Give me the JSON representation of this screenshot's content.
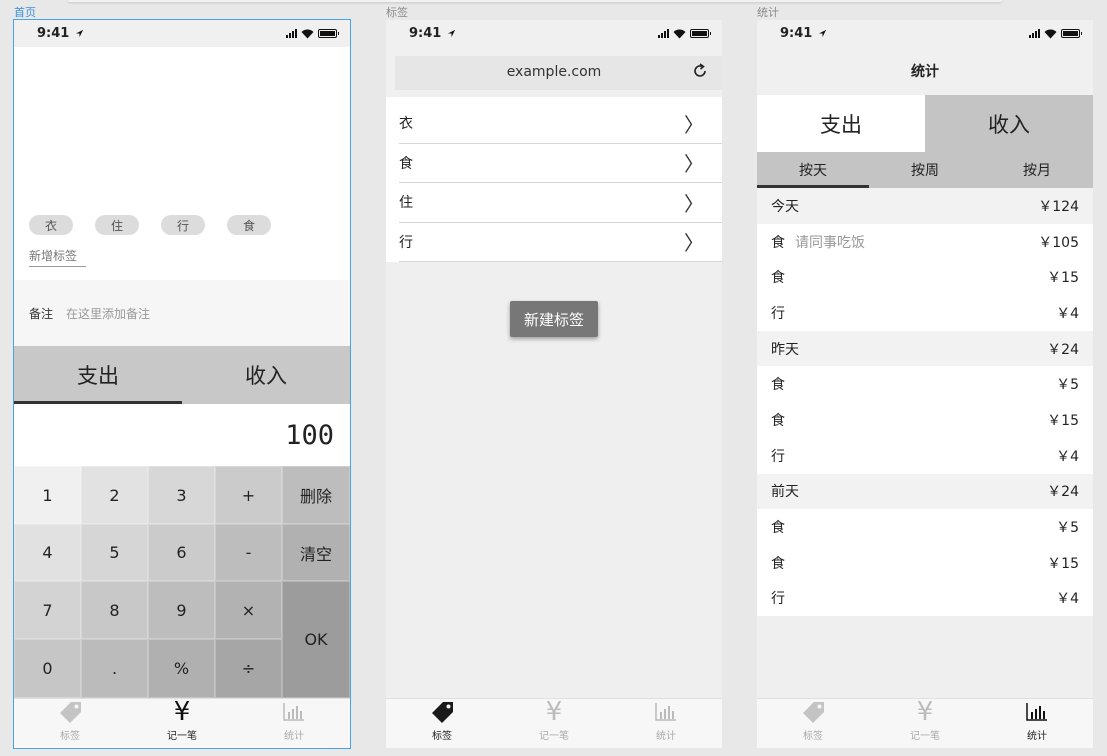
{
  "artboards": {
    "home": "首页",
    "tags": "标签",
    "stats": "统计"
  },
  "status": {
    "time": "9:41"
  },
  "home": {
    "tags": [
      "衣",
      "住",
      "行",
      "食"
    ],
    "new_tag": "新增标签",
    "note_label": "备注",
    "note_placeholder": "在这里添加备注",
    "types": [
      "支出",
      "收入"
    ],
    "amount": "100",
    "keys": [
      "1",
      "2",
      "3",
      "+",
      "删除",
      "4",
      "5",
      "6",
      "-",
      "清空",
      "7",
      "8",
      "9",
      "×",
      "OK",
      "0",
      ".",
      "%",
      "÷"
    ],
    "key_colors": {
      "k1": "#f0f0f0",
      "k2": "#e2e2e2",
      "k3": "#d7d7d7",
      "kplus": "#cbcbcb",
      "kdel": "#bdbdbd",
      "k4": "#e1e1e1",
      "k5": "#d6d6d6",
      "k6": "#cbcbcb",
      "kminus": "#bdbdbd",
      "kclr": "#b1b1b1",
      "k7": "#d3d3d3",
      "k8": "#c8c8c8",
      "k9": "#bdbdbd",
      "kmul": "#b2b2b2",
      "kok": "#9c9c9c",
      "k0": "#c6c6c6",
      "kdot": "#bbbbbb",
      "kpct": "#b0b0b0",
      "kdiv": "#a6a6a6"
    }
  },
  "tabbar": {
    "tags": "标签",
    "record": "记一笔",
    "stats": "统计"
  },
  "tags_page": {
    "url": "example.com",
    "categories": [
      "衣",
      "食",
      "住",
      "行"
    ],
    "new_button": "新建标签"
  },
  "stats_page": {
    "title": "统计",
    "types": [
      "支出",
      "收入"
    ],
    "periods": [
      "按天",
      "按周",
      "按月"
    ],
    "rows": [
      {
        "label": "今天",
        "note": "",
        "amount": "￥124",
        "header": true
      },
      {
        "label": "食",
        "note": "请同事吃饭",
        "amount": "￥105",
        "header": false
      },
      {
        "label": "食",
        "note": "",
        "amount": "￥15",
        "header": false
      },
      {
        "label": "行",
        "note": "",
        "amount": "￥4",
        "header": false
      },
      {
        "label": "昨天",
        "note": "",
        "amount": "￥24",
        "header": true
      },
      {
        "label": "食",
        "note": "",
        "amount": "￥5",
        "header": false
      },
      {
        "label": "食",
        "note": "",
        "amount": "￥15",
        "header": false
      },
      {
        "label": "行",
        "note": "",
        "amount": "￥4",
        "header": false
      },
      {
        "label": "前天",
        "note": "",
        "amount": "￥24",
        "header": true
      },
      {
        "label": "食",
        "note": "",
        "amount": "￥5",
        "header": false
      },
      {
        "label": "食",
        "note": "",
        "amount": "￥15",
        "header": false
      },
      {
        "label": "行",
        "note": "",
        "amount": "￥4",
        "header": false
      }
    ]
  }
}
